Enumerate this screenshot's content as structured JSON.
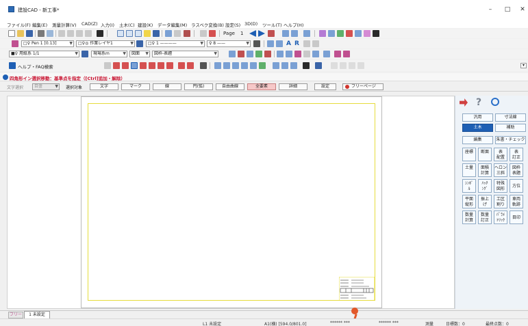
{
  "window": {
    "title": "建設CAD - 新工事*",
    "minimize": "–",
    "maximize": "□",
    "close": "✕"
  },
  "menu": [
    "ファイル(F)",
    "編集(E)",
    "測量計算(V)",
    "CAD(Z)",
    "入力(I)",
    "土木(C)",
    "建設(K)",
    "データ編集(M)",
    "ラスベク変換(B)",
    "設定(S)",
    "3D(D)",
    "ツール(T)",
    "ヘルプ(H)"
  ],
  "toolbar1": {
    "page_label": "Page",
    "page_number": "1"
  },
  "toolbar2": {
    "pen_combo": "□♀ Pen 1 [0.13]",
    "layer_combo": "□♀◎ 作業レイヤ1",
    "linetype_combo": "□♀ 1 ————",
    "color_combo": "♀ 8 ——",
    "text_tools": [
      "A",
      "R"
    ]
  },
  "toolbar3": {
    "paper_combo": "■♀ 用紙系 1/1",
    "coord_combo": "現場系m",
    "view_combo": "図面",
    "layout_combo": "図枠-表題"
  },
  "toolbar4": {
    "help_search": "ヘルプ・FAQ検索"
  },
  "command": {
    "prompt": "四角形イン選択移動：基準点を指定（[Ctrl]追加・解除）",
    "text_select_label": "文字選択",
    "text_select_value": "目盛",
    "target_label": "選択対象",
    "options": [
      "文字",
      "マーク",
      "線",
      "円(弧)",
      "自由曲線",
      "全要素",
      "詳細",
      "設定"
    ],
    "free_page": "フリーページ"
  },
  "palette": {
    "top_buttons": [
      "汎用",
      "寸法線",
      "土木",
      "補助",
      "編集",
      "朱書・チェック"
    ],
    "grid_buttons": [
      "座標",
      "断面",
      "表\n配置",
      "表\n訂正",
      "土量",
      "面積\n計算",
      "ヘロン\n三斜",
      "図枠\n表題",
      "ｼﾝﾎﾞ\nﾙ",
      "ﾊｯﾁ\nﾝｸﾞ",
      "特殊\n図形",
      "方位",
      "平面\n縦形",
      "振上\nげ",
      "工区\n割り",
      "車両\n軌跡",
      "数量\n計算",
      "数量\n訂正",
      "ﾊﾟﾗﾒ\nﾄﾘｯｸ",
      "目印"
    ]
  },
  "tabs": {
    "free_tab": "フリー",
    "page_tab": "1 未設定"
  },
  "statusbar": {
    "layer": "L1 未設定",
    "paper": "A1(横) [594.0/801.0]",
    "coord1": "****** ***",
    "coord2": "****** ***",
    "mode": "測量",
    "grid_count": "日標数：0",
    "element_count": "最終点数：0"
  },
  "colors": {
    "accent_blue": "#1e5fb4",
    "frame_yellow": "#e6dc3c",
    "prompt_red": "#c8102e",
    "pin_orange": "#e2582a"
  }
}
